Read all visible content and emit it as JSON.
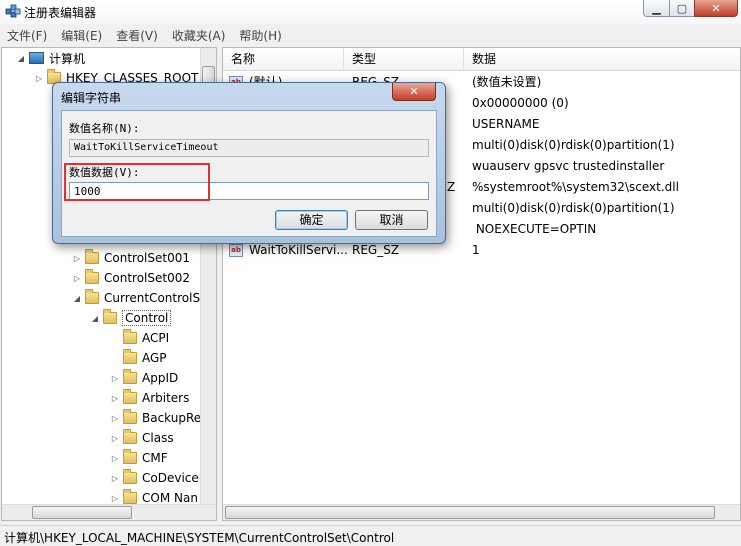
{
  "window": {
    "title": "注册表编辑器"
  },
  "menu": [
    {
      "label": "文件(F)"
    },
    {
      "label": "编辑(E)"
    },
    {
      "label": "查看(V)"
    },
    {
      "label": "收藏夹(A)"
    },
    {
      "label": "帮助(H)"
    }
  ],
  "tree": {
    "root": "计算机",
    "items": [
      {
        "label": "HKEY_CLASSES_ROOT",
        "expander": "▷"
      },
      {
        "label": "ControlSet001",
        "expander": "▷"
      },
      {
        "label": "ControlSet002",
        "expander": "▷"
      },
      {
        "label": "CurrentControlSe",
        "expander": "◢"
      },
      {
        "label": "Control",
        "expander": "◢",
        "selected": true
      },
      {
        "label": "ACPI",
        "expander": ""
      },
      {
        "label": "AGP",
        "expander": ""
      },
      {
        "label": "AppID",
        "expander": "▷"
      },
      {
        "label": "Arbiters",
        "expander": "▷"
      },
      {
        "label": "BackupRe",
        "expander": "▷"
      },
      {
        "label": "Class",
        "expander": "▷"
      },
      {
        "label": "CMF",
        "expander": "▷"
      },
      {
        "label": "CoDeviceI",
        "expander": "▷"
      },
      {
        "label": "COM Nan",
        "expander": "▷"
      }
    ]
  },
  "list": {
    "columns": {
      "name": "名称",
      "type": "类型",
      "data": "数据"
    },
    "rows": [
      {
        "name": "(默认)",
        "type": "REG_SZ",
        "data": "(数值未设置)"
      },
      {
        "name": "",
        "type": "",
        "data": "0x00000000 (0)"
      },
      {
        "name": "",
        "type": "",
        "data": "USERNAME"
      },
      {
        "name": "",
        "type": "",
        "data": "multi(0)disk(0)rdisk(0)partition(1)"
      },
      {
        "name": "",
        "type": "",
        "data": "wuauserv gpsvc trustedinstaller"
      },
      {
        "name": "",
        "type": "Z",
        "data": "%systemroot%\\system32\\scext.dll"
      },
      {
        "name": "",
        "type": "",
        "data": "multi(0)disk(0)rdisk(0)partition(1)"
      },
      {
        "name": "",
        "type": "",
        "data": " NOEXECUTE=OPTIN"
      },
      {
        "name": "WaitToKillServi...",
        "type": "REG_SZ",
        "data": "1"
      }
    ]
  },
  "status": {
    "path": "计算机\\HKEY_LOCAL_MACHINE\\SYSTEM\\CurrentControlSet\\Control"
  },
  "dialog": {
    "title": "编辑字符串",
    "name_label": "数值名称(N):",
    "name_value": "WaitToKillServiceTimeout",
    "data_label": "数值数据(V):",
    "data_value": "1000",
    "ok_label": "确定",
    "cancel_label": "取消"
  },
  "colors": {
    "highlight": "#e03030",
    "dialog_frame": "#a8c1de",
    "close_button": "#c23c26"
  }
}
